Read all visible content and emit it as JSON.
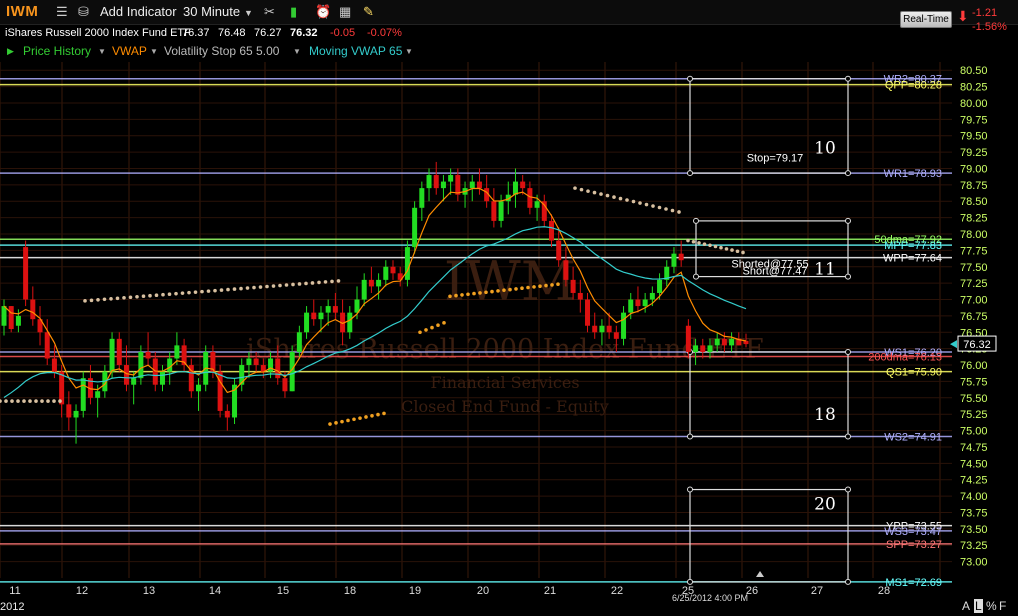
{
  "toolbar": {
    "symbol": "IWM",
    "add_indicator_label": "Add Indicator",
    "interval_label": "30 Minute",
    "icons": [
      "list-icon",
      "save-icon",
      "wrench-icon",
      "bar-style-icon",
      "alarm-icon",
      "calculator-icon",
      "note-icon"
    ]
  },
  "quote": {
    "name": "iShares Russell 2000 Index Fund ETF",
    "open": "76.37",
    "high": "76.48",
    "low": "76.27",
    "last": "76.32",
    "change": "-0.05",
    "change_pct": "-0.07%"
  },
  "legend": {
    "price_history": "Price History",
    "vwap": "VWAP",
    "volatility_stop": "Volatility Stop 65 5.00",
    "moving_vwap": "Moving VWAP 65"
  },
  "realtime": {
    "label": "Real-Time",
    "change": "-1.21",
    "change_pct": "-1.56%"
  },
  "colors": {
    "price_history": "#33cc33",
    "vwap": "#ff8c00",
    "volatility_stop": "#aaaaaa",
    "moving_vwap": "#33cccc",
    "up": "#22dd22",
    "down": "#dd1111"
  },
  "watermark": {
    "symbol": "IWM",
    "name": "iShares Russell 2000 Index Fund ETF",
    "sector": "Financial Services",
    "type": "Closed End Fund - Equity"
  },
  "bottom": {
    "year": "2012",
    "datetime": "6/25/2012 4:00 PM",
    "icons": [
      "A",
      "L",
      "%",
      "F"
    ]
  },
  "chart_data": {
    "type": "candlestick",
    "x_ticks": [
      "11",
      "12",
      "13",
      "14",
      "15",
      "18",
      "19",
      "20",
      "21",
      "22",
      "25",
      "26",
      "27",
      "28"
    ],
    "ylim": [
      72.75,
      80.625
    ],
    "y_ticks": [
      "80.50",
      "80.25",
      "80.00",
      "79.75",
      "79.50",
      "79.25",
      "79.00",
      "78.75",
      "78.50",
      "78.25",
      "78.00",
      "77.75",
      "77.50",
      "77.25",
      "77.00",
      "76.75",
      "76.50",
      "76.25",
      "76.00",
      "75.75",
      "75.50",
      "75.25",
      "75.00",
      "74.75",
      "74.50",
      "74.25",
      "74.00",
      "73.75",
      "73.50",
      "73.25",
      "73.00"
    ],
    "last_price": "76.32",
    "levels": [
      {
        "label": "WR2=80.37",
        "value": 80.37,
        "color": "#b0b0ff"
      },
      {
        "label": "QPP=80.28",
        "value": 80.28,
        "color": "#ffff66"
      },
      {
        "label": "WR1=78.93",
        "value": 78.93,
        "color": "#b0b0ff"
      },
      {
        "label": "50dma=77.92",
        "value": 77.92,
        "color": "#99ff66"
      },
      {
        "label": "MPP=77.83",
        "value": 77.83,
        "color": "#66ffff"
      },
      {
        "label": "WPP=77.64",
        "value": 77.64,
        "color": "#ffffff"
      },
      {
        "label": "WS1=76.20",
        "value": 76.2,
        "color": "#b0b0ff"
      },
      {
        "label": "200dma=76.13",
        "value": 76.13,
        "color": "#ff5555"
      },
      {
        "label": "QS1=75.90",
        "value": 75.9,
        "color": "#ffff66"
      },
      {
        "label": "WS2=74.91",
        "value": 74.91,
        "color": "#b0b0ff"
      },
      {
        "label": "YPP=73.55",
        "value": 73.55,
        "color": "#ffffff"
      },
      {
        "label": "WS3=73.47",
        "value": 73.47,
        "color": "#b0b0ff"
      },
      {
        "label": "SPP=73.27",
        "value": 73.27,
        "color": "#ff7777"
      },
      {
        "label": "MS1=72.69",
        "value": 72.69,
        "color": "#66ffff"
      }
    ],
    "annotations": [
      {
        "label": "Stop=79.17",
        "value": 79.17
      },
      {
        "label": "Shorted@77.55",
        "value": 77.55
      },
      {
        "label": "Short@77.47",
        "value": 77.47
      }
    ],
    "boxes": [
      {
        "label": "10",
        "top": 80.37,
        "bottom": 78.93
      },
      {
        "label": "11",
        "top": 78.2,
        "bottom": 77.35
      },
      {
        "label": "18",
        "top": 76.2,
        "bottom": 74.91
      },
      {
        "label": "20",
        "top": 74.1,
        "bottom": 72.69
      }
    ],
    "candles": [
      [
        76.6,
        77.0,
        76.45,
        76.9
      ],
      [
        76.9,
        76.9,
        76.5,
        76.55
      ],
      [
        76.6,
        76.85,
        76.5,
        76.75
      ],
      [
        77.8,
        77.9,
        76.9,
        77.0
      ],
      [
        77.0,
        77.2,
        76.6,
        76.7
      ],
      [
        76.7,
        76.9,
        76.3,
        76.5
      ],
      [
        76.5,
        76.7,
        76.0,
        76.1
      ],
      [
        76.1,
        76.3,
        75.8,
        75.9
      ],
      [
        75.9,
        76.0,
        75.2,
        75.4
      ],
      [
        75.4,
        75.6,
        75.0,
        75.2
      ],
      [
        75.2,
        75.4,
        74.8,
        75.3
      ],
      [
        75.3,
        75.9,
        75.2,
        75.8
      ],
      [
        75.8,
        76.0,
        75.4,
        75.5
      ],
      [
        75.5,
        75.7,
        75.2,
        75.6
      ],
      [
        75.6,
        76.0,
        75.5,
        75.9
      ],
      [
        75.9,
        76.5,
        75.8,
        76.4
      ],
      [
        76.4,
        76.5,
        75.9,
        76.0
      ],
      [
        76.0,
        76.3,
        75.6,
        75.7
      ],
      [
        75.7,
        75.9,
        75.4,
        75.8
      ],
      [
        75.8,
        76.3,
        75.7,
        76.2
      ],
      [
        76.2,
        76.5,
        76.0,
        76.1
      ],
      [
        76.1,
        76.2,
        75.6,
        75.7
      ],
      [
        75.7,
        76.0,
        75.6,
        75.9
      ],
      [
        75.9,
        76.2,
        75.7,
        76.1
      ],
      [
        76.1,
        76.5,
        76.0,
        76.3
      ],
      [
        76.3,
        76.4,
        75.9,
        76.0
      ],
      [
        76.0,
        76.1,
        75.5,
        75.6
      ],
      [
        75.6,
        75.8,
        75.3,
        75.7
      ],
      [
        75.7,
        76.3,
        75.6,
        76.2
      ],
      [
        76.2,
        76.3,
        75.8,
        75.9
      ],
      [
        75.9,
        76.0,
        75.2,
        75.3
      ],
      [
        75.3,
        75.4,
        75.0,
        75.2
      ],
      [
        75.2,
        75.8,
        75.1,
        75.7
      ],
      [
        75.7,
        76.1,
        75.6,
        76.0
      ],
      [
        76.0,
        76.2,
        75.8,
        76.1
      ],
      [
        76.1,
        76.2,
        75.9,
        76.0
      ],
      [
        76.0,
        76.1,
        75.8,
        75.9
      ],
      [
        75.9,
        76.2,
        75.8,
        76.1
      ],
      [
        76.1,
        76.3,
        75.7,
        75.8
      ],
      [
        75.8,
        75.9,
        75.5,
        75.6
      ],
      [
        75.6,
        76.3,
        75.6,
        76.2
      ],
      [
        76.2,
        76.6,
        76.1,
        76.5
      ],
      [
        76.5,
        76.9,
        76.4,
        76.8
      ],
      [
        76.8,
        77.0,
        76.6,
        76.7
      ],
      [
        76.7,
        76.9,
        76.5,
        76.8
      ],
      [
        76.8,
        77.0,
        76.6,
        76.9
      ],
      [
        76.9,
        77.1,
        76.7,
        76.8
      ],
      [
        76.8,
        77.0,
        76.3,
        76.5
      ],
      [
        76.5,
        76.9,
        76.4,
        76.8
      ],
      [
        76.8,
        77.2,
        76.7,
        77.0
      ],
      [
        77.0,
        77.4,
        76.9,
        77.3
      ],
      [
        77.3,
        77.5,
        77.1,
        77.2
      ],
      [
        77.2,
        77.4,
        77.0,
        77.3
      ],
      [
        77.3,
        77.6,
        77.2,
        77.5
      ],
      [
        77.5,
        77.6,
        77.3,
        77.4
      ],
      [
        77.4,
        77.5,
        77.2,
        77.3
      ],
      [
        77.3,
        77.9,
        77.2,
        77.8
      ],
      [
        77.8,
        78.5,
        77.7,
        78.4
      ],
      [
        78.4,
        78.8,
        78.2,
        78.7
      ],
      [
        78.7,
        79.0,
        78.5,
        78.9
      ],
      [
        78.9,
        79.1,
        78.6,
        78.7
      ],
      [
        78.7,
        78.9,
        78.5,
        78.8
      ],
      [
        78.8,
        79.0,
        78.6,
        78.9
      ],
      [
        78.9,
        79.0,
        78.5,
        78.6
      ],
      [
        78.6,
        78.8,
        78.4,
        78.7
      ],
      [
        78.7,
        78.9,
        78.5,
        78.8
      ],
      [
        78.8,
        79.0,
        78.6,
        78.7
      ],
      [
        78.7,
        78.9,
        78.4,
        78.5
      ],
      [
        78.5,
        78.7,
        78.1,
        78.2
      ],
      [
        78.2,
        78.6,
        78.1,
        78.5
      ],
      [
        78.5,
        78.8,
        78.3,
        78.6
      ],
      [
        78.6,
        79.0,
        78.4,
        78.8
      ],
      [
        78.8,
        78.9,
        78.6,
        78.7
      ],
      [
        78.7,
        78.8,
        78.3,
        78.4
      ],
      [
        78.4,
        78.6,
        78.2,
        78.5
      ],
      [
        78.5,
        78.6,
        78.1,
        78.2
      ],
      [
        78.2,
        78.3,
        77.8,
        77.9
      ],
      [
        77.9,
        78.1,
        77.5,
        77.6
      ],
      [
        77.6,
        77.8,
        77.2,
        77.3
      ],
      [
        77.3,
        77.5,
        77.0,
        77.1
      ],
      [
        77.1,
        77.3,
        76.8,
        77.0
      ],
      [
        77.0,
        77.1,
        76.5,
        76.6
      ],
      [
        76.6,
        76.8,
        76.4,
        76.5
      ],
      [
        76.5,
        76.7,
        76.3,
        76.6
      ],
      [
        76.6,
        76.8,
        76.4,
        76.5
      ],
      [
        76.5,
        76.6,
        76.2,
        76.4
      ],
      [
        76.4,
        76.9,
        76.3,
        76.8
      ],
      [
        76.8,
        77.1,
        76.7,
        77.0
      ],
      [
        77.0,
        77.2,
        76.8,
        76.9
      ],
      [
        76.9,
        77.1,
        76.8,
        77.0
      ],
      [
        77.0,
        77.2,
        76.9,
        77.1
      ],
      [
        77.1,
        77.4,
        77.0,
        77.3
      ],
      [
        77.3,
        77.6,
        77.2,
        77.5
      ],
      [
        77.5,
        77.8,
        77.4,
        77.7
      ],
      [
        77.7,
        77.9,
        77.5,
        77.6
      ],
      [
        76.6,
        76.7,
        76.1,
        76.2
      ],
      [
        76.2,
        76.4,
        76.0,
        76.3
      ],
      [
        76.3,
        76.4,
        76.1,
        76.2
      ],
      [
        76.2,
        76.4,
        76.1,
        76.3
      ],
      [
        76.3,
        76.5,
        76.2,
        76.4
      ],
      [
        76.4,
        76.5,
        76.2,
        76.3
      ],
      [
        76.3,
        76.5,
        76.2,
        76.4
      ],
      [
        76.4,
        76.5,
        76.3,
        76.3
      ],
      [
        76.37,
        76.48,
        76.27,
        76.32
      ]
    ]
  }
}
